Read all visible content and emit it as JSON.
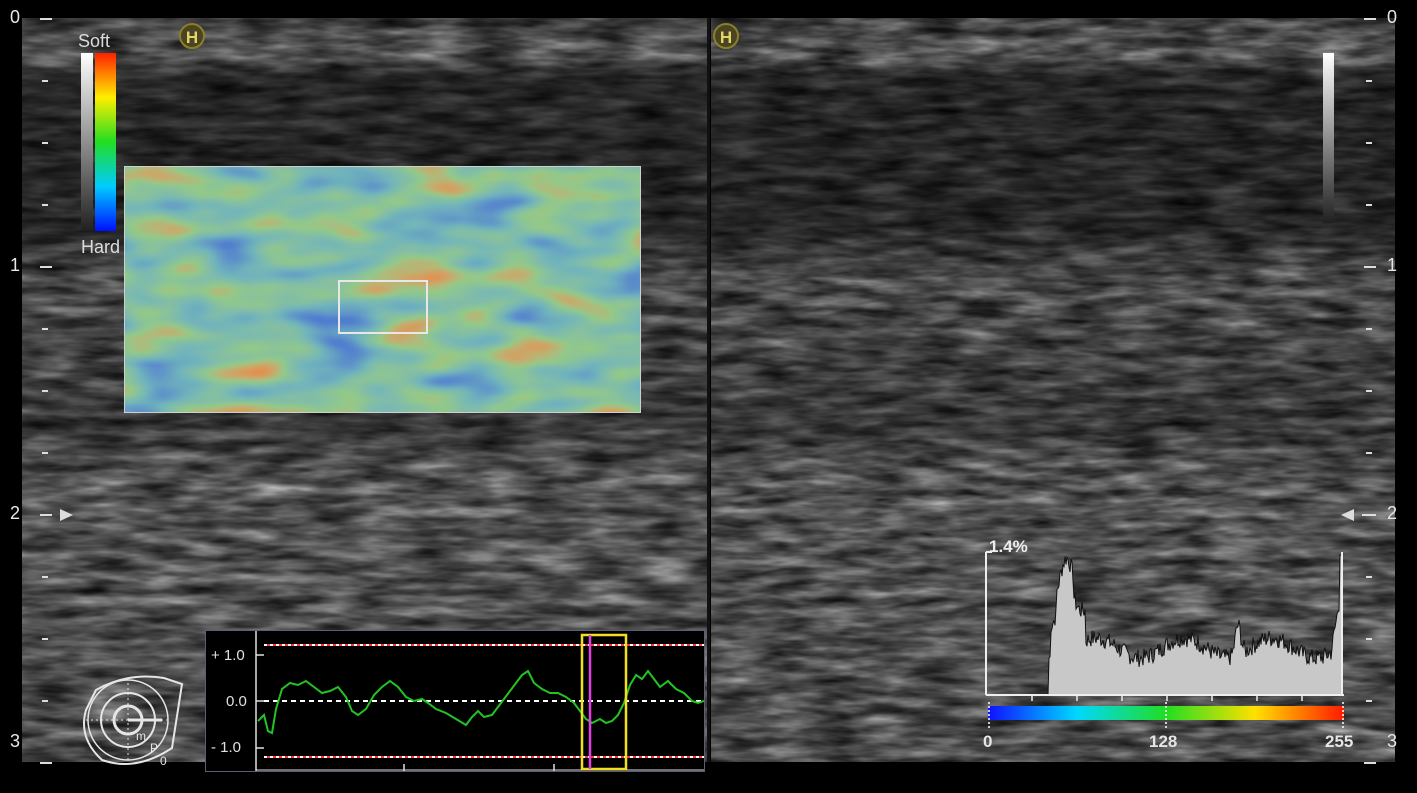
{
  "left_panel": {
    "mode_badge": "H",
    "color_scale": {
      "top_label": "Soft",
      "bottom_label": "Hard"
    }
  },
  "right_panel": {
    "mode_badge": "H"
  },
  "depth_ruler": {
    "left": [
      "0",
      "1",
      "2",
      "3"
    ],
    "right": [
      "0",
      "1",
      "2",
      "3"
    ]
  },
  "strain_graph": {
    "y_labels": [
      "+ 1.0",
      "0.0",
      "- 1.0"
    ]
  },
  "probe_icon": {
    "labels": [
      "m",
      "P",
      "0"
    ]
  },
  "histogram": {
    "peak_label": "1.4%",
    "axis_labels": [
      "0",
      "128",
      "255"
    ]
  },
  "colors": {
    "strain_line": "#22c422",
    "reference_dash": "#ff3030",
    "selection_box": "#f0e020",
    "cursor": "#e040e0"
  }
}
